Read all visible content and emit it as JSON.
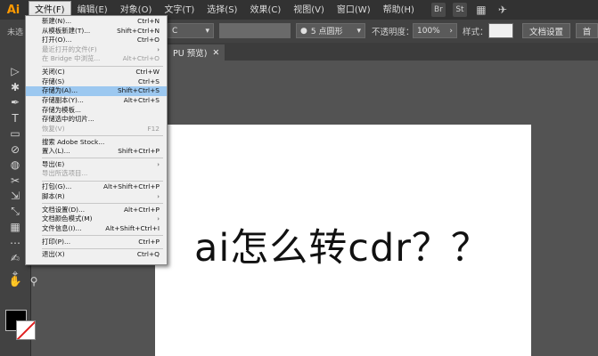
{
  "app": {
    "logo": "Ai"
  },
  "menubar": {
    "items": [
      "文件(F)",
      "编辑(E)",
      "对象(O)",
      "文字(T)",
      "选择(S)",
      "效果(C)",
      "视图(V)",
      "窗口(W)",
      "帮助(H)"
    ],
    "right_icons": [
      "Br",
      "St",
      "▦",
      "✈"
    ]
  },
  "controlbar": {
    "left_label": "未选",
    "stroke_label": "C",
    "brush_value": "5 点圆形",
    "opacity_label": "不透明度：",
    "opacity_value": "100%",
    "style_label": "样式：",
    "doc_settings": "文档设置",
    "preferences": "首"
  },
  "tab": {
    "label": "PU 预览)",
    "close": "✕"
  },
  "artboard": {
    "text": "ai怎么转cdr？？"
  },
  "file_menu": {
    "items": [
      {
        "label": "新建(N)...",
        "shortcut": "Ctrl+N"
      },
      {
        "label": "从模板新建(T)...",
        "shortcut": "Shift+Ctrl+N"
      },
      {
        "label": "打开(O)...",
        "shortcut": "Ctrl+O"
      },
      {
        "label": "最近打开的文件(F)",
        "shortcut": "›",
        "disabled": true
      },
      {
        "label": "在 Bridge 中浏览...",
        "shortcut": "Alt+Ctrl+O",
        "disabled": true
      },
      {
        "sep": true
      },
      {
        "label": "关闭(C)",
        "shortcut": "Ctrl+W"
      },
      {
        "label": "存储(S)",
        "shortcut": "Ctrl+S"
      },
      {
        "label": "存储为(A)...",
        "shortcut": "Shift+Ctrl+S",
        "highlight": true
      },
      {
        "label": "存储副本(Y)...",
        "shortcut": "Alt+Ctrl+S"
      },
      {
        "label": "存储为模板...",
        "shortcut": ""
      },
      {
        "label": "存储选中的切片...",
        "shortcut": ""
      },
      {
        "label": "恢复(V)",
        "shortcut": "F12",
        "disabled": true
      },
      {
        "sep": true
      },
      {
        "label": "搜索 Adobe Stock...",
        "shortcut": ""
      },
      {
        "label": "置入(L)...",
        "shortcut": "Shift+Ctrl+P"
      },
      {
        "sep": true
      },
      {
        "label": "导出(E)",
        "shortcut": "›"
      },
      {
        "label": "导出所选项目...",
        "shortcut": "",
        "disabled": true
      },
      {
        "sep": true
      },
      {
        "label": "打包(G)...",
        "shortcut": "Alt+Shift+Ctrl+P"
      },
      {
        "label": "脚本(R)",
        "shortcut": "›"
      },
      {
        "sep": true
      },
      {
        "label": "文档设置(D)...",
        "shortcut": "Alt+Ctrl+P"
      },
      {
        "label": "文档颜色模式(M)",
        "shortcut": "›"
      },
      {
        "label": "文件信息(I)...",
        "shortcut": "Alt+Shift+Ctrl+I"
      },
      {
        "sep": true
      },
      {
        "label": "打印(P)...",
        "shortcut": "Ctrl+P"
      },
      {
        "sep": true
      },
      {
        "label": "退出(X)",
        "shortcut": "Ctrl+Q"
      }
    ]
  },
  "tools": [
    "▷",
    "✱",
    "✒",
    "T",
    "▭",
    "⊘",
    "◍",
    "✂",
    "⇲",
    "⤡",
    "▦",
    "⋯",
    "✍",
    "⌖",
    "✋",
    "⚲"
  ]
}
